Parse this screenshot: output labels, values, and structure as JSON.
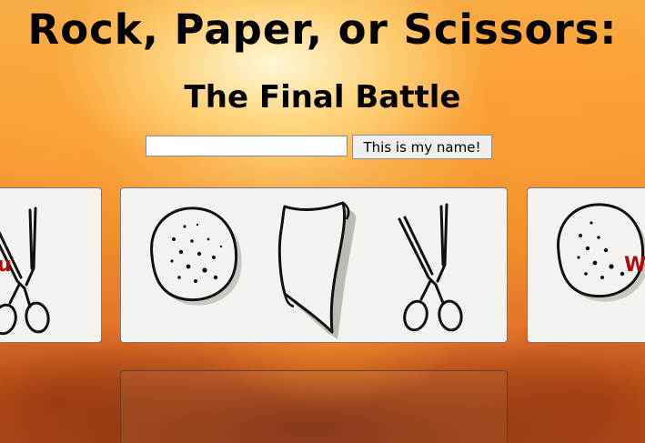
{
  "header": {
    "title": "Rock, Paper, or Scissors:",
    "subtitle": "The Final Battle"
  },
  "name_form": {
    "input_value": "",
    "button_label": "This is my name!"
  },
  "choices": [
    {
      "label": "rock",
      "icon": "rock-icon"
    },
    {
      "label": "paper",
      "icon": "paper-icon"
    },
    {
      "label": "scissors",
      "icon": "scissors-icon"
    }
  ],
  "side_cards": {
    "left_badge": "u",
    "right_badge": "W"
  },
  "colors": {
    "badge": "#b20a0a",
    "card_bg": "#f3f2ef"
  }
}
